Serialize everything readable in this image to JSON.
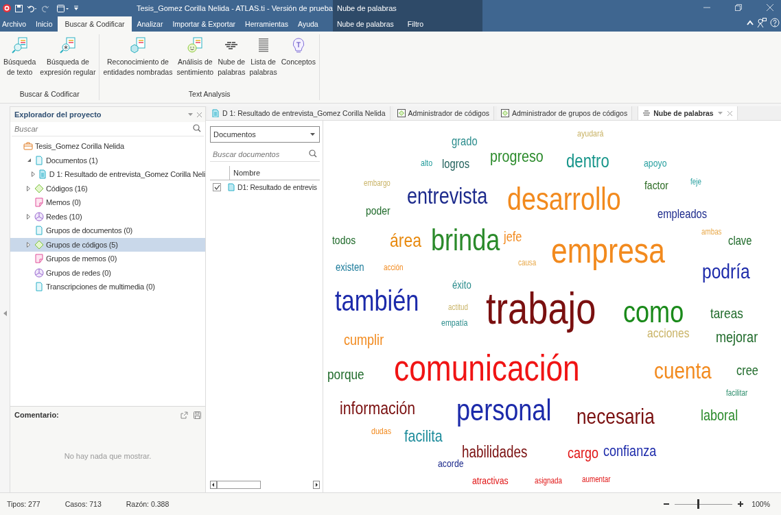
{
  "window": {
    "title": "Tesis_Gomez Corilla Nelida - ATLAS.ti - Versión de prueba",
    "context_title": "Nube de palabras"
  },
  "menu_tabs": [
    {
      "label": "Archivo",
      "selected": false
    },
    {
      "label": "Inicio",
      "selected": false
    },
    {
      "label": "Buscar & Codificar",
      "selected": true
    },
    {
      "label": "Analizar",
      "selected": false
    },
    {
      "label": "Importar & Exportar",
      "selected": false
    },
    {
      "label": "Herramientas",
      "selected": false
    },
    {
      "label": "Ayuda",
      "selected": false
    }
  ],
  "context_tabs": [
    {
      "label": "Nube de palabras",
      "selected": false
    },
    {
      "label": "Filtro",
      "selected": false
    }
  ],
  "ribbon_groups": [
    {
      "label": "Buscar & Codificar",
      "buttons": [
        {
          "label": "Búsqueda\nde texto",
          "kind": "text-search"
        },
        {
          "label": "Búsqueda de\nexpresión regular",
          "kind": "regex-search"
        }
      ]
    },
    {
      "label": "Text Analysis",
      "buttons": [
        {
          "label": "Reconocimiento de\nentidades nombradas",
          "kind": "entities"
        },
        {
          "label": "Análisis de\nsentimiento",
          "kind": "sentiment"
        },
        {
          "label": "Nube de\npalabras",
          "kind": "cloud"
        },
        {
          "label": "Lista de\npalabras",
          "kind": "list"
        },
        {
          "label": "Conceptos",
          "kind": "concepts"
        }
      ]
    }
  ],
  "explorer": {
    "title": "Explorador del proyecto",
    "search_placeholder": "Buscar",
    "tree": [
      {
        "label": "Tesis_Gomez Corilla Nelida",
        "kind": "project",
        "selected": false,
        "children": [
          {
            "label": "Documentos (1)",
            "kind": "documents",
            "expanded": true,
            "selected": false,
            "children": [
              {
                "label": "D 1: Resultado de entrevista_Gomez Corilla Neli",
                "kind": "document",
                "expanded": false,
                "selected": false
              }
            ]
          },
          {
            "label": "Códigos (16)",
            "kind": "codes",
            "expanded": false,
            "selected": false
          },
          {
            "label": "Memos (0)",
            "kind": "memos",
            "selected": false
          },
          {
            "label": "Redes (10)",
            "kind": "networks",
            "expanded": false,
            "selected": false
          },
          {
            "label": "Grupos de documentos (0)",
            "kind": "documents",
            "selected": false
          },
          {
            "label": "Grupos de códigos (5)",
            "kind": "codes",
            "expanded": false,
            "selected": true
          },
          {
            "label": "Grupos de memos (0)",
            "kind": "memos",
            "selected": false
          },
          {
            "label": "Grupos de redes (0)",
            "kind": "networks",
            "selected": false
          },
          {
            "label": "Transcripciones de multimedia (0)",
            "kind": "documents",
            "selected": false
          }
        ]
      }
    ]
  },
  "comment": {
    "title": "Comentario:",
    "empty_text": "No hay nada que mostrar."
  },
  "doc_tabs": [
    {
      "label": "D 1: Resultado de entrevista_Gomez Corilla Nelida",
      "kind": "document",
      "selected": false
    },
    {
      "label": "Administrador de códigos",
      "kind": "manager",
      "selected": false
    },
    {
      "label": "Administrador de grupos de códigos",
      "kind": "manager",
      "selected": false
    },
    {
      "label": "Nube de palabras",
      "kind": "cloud",
      "selected": true
    }
  ],
  "documents_pane": {
    "dropdown": "Documentos",
    "search_placeholder": "Buscar documentos",
    "column": "Nombre",
    "rows": [
      {
        "name": "D1: Resultado de entrevis",
        "checked": true
      }
    ]
  },
  "word_cloud": [
    {
      "text": "grado",
      "color": "#2a8c8c"
    },
    {
      "text": "ayudará",
      "color": "#c9b366"
    },
    {
      "text": "alto",
      "color": "#1f9a9a"
    },
    {
      "text": "logros",
      "color": "#1f5f5a"
    },
    {
      "text": "progreso",
      "color": "#2a8a2a"
    },
    {
      "text": "dentro",
      "color": "#17958a"
    },
    {
      "text": "apoyo",
      "color": "#2aa0a0"
    },
    {
      "text": "embargo",
      "color": "#c9b366"
    },
    {
      "text": "entrevista",
      "color": "#1c2a8c"
    },
    {
      "text": "desarrollo",
      "color": "#f28a1e"
    },
    {
      "text": "factor",
      "color": "#2a6a22"
    },
    {
      "text": "feje",
      "color": "#2aa0a0"
    },
    {
      "text": "poder",
      "color": "#1f6a2a"
    },
    {
      "text": "empleados",
      "color": "#1c2a8c"
    },
    {
      "text": "todos",
      "color": "#1f6a2a"
    },
    {
      "text": "área",
      "color": "#e88a10"
    },
    {
      "text": "brinda",
      "color": "#2a8a2a"
    },
    {
      "text": "jefe",
      "color": "#f28a1e"
    },
    {
      "text": "ambas",
      "color": "#e8a848"
    },
    {
      "text": "clave",
      "color": "#1f6a2a"
    },
    {
      "text": "existen",
      "color": "#1a7a9a"
    },
    {
      "text": "acción",
      "color": "#f28a1e"
    },
    {
      "text": "causa",
      "color": "#e8a848"
    },
    {
      "text": "empresa",
      "color": "#f28a1e"
    },
    {
      "text": "podría",
      "color": "#1c2aaa"
    },
    {
      "text": "éxito",
      "color": "#2a8c8c"
    },
    {
      "text": "también",
      "color": "#1c2aaa"
    },
    {
      "text": "actitud",
      "color": "#c9b366"
    },
    {
      "text": "trabajo",
      "color": "#7a1010"
    },
    {
      "text": "como",
      "color": "#1a8a1a"
    },
    {
      "text": "tareas",
      "color": "#1f6a2a"
    },
    {
      "text": "empatía",
      "color": "#2a8c8c"
    },
    {
      "text": "cumplir",
      "color": "#f28a1e"
    },
    {
      "text": "acciones",
      "color": "#c9b366"
    },
    {
      "text": "mejorar",
      "color": "#1f6a2a"
    },
    {
      "text": "porque",
      "color": "#1f6a2a"
    },
    {
      "text": "comunicación",
      "color": "#f01414"
    },
    {
      "text": "cuenta",
      "color": "#f28a1e"
    },
    {
      "text": "cree",
      "color": "#1f6a2a"
    },
    {
      "text": "facilitar",
      "color": "#2a8c6a"
    },
    {
      "text": "información",
      "color": "#7a1010"
    },
    {
      "text": "personal",
      "color": "#1c2aaa"
    },
    {
      "text": "necesaria",
      "color": "#7a1010"
    },
    {
      "text": "laboral",
      "color": "#2a8a2a"
    },
    {
      "text": "dudas",
      "color": "#f28a1e"
    },
    {
      "text": "facilita",
      "color": "#1a8a9a"
    },
    {
      "text": "habilidades",
      "color": "#7a1010"
    },
    {
      "text": "cargo",
      "color": "#e01414"
    },
    {
      "text": "confianza",
      "color": "#1c2aaa"
    },
    {
      "text": "acorde",
      "color": "#1c2a8c"
    },
    {
      "text": "atractivas",
      "color": "#e01414"
    },
    {
      "text": "asignada",
      "color": "#e01414"
    },
    {
      "text": "aumentar",
      "color": "#e01414"
    }
  ],
  "status_bar": {
    "items": [
      "Tipos: 277",
      "Casos: 713",
      "Razón: 0.388"
    ],
    "zoom": {
      "level": 0.4,
      "reading": "100%"
    }
  }
}
